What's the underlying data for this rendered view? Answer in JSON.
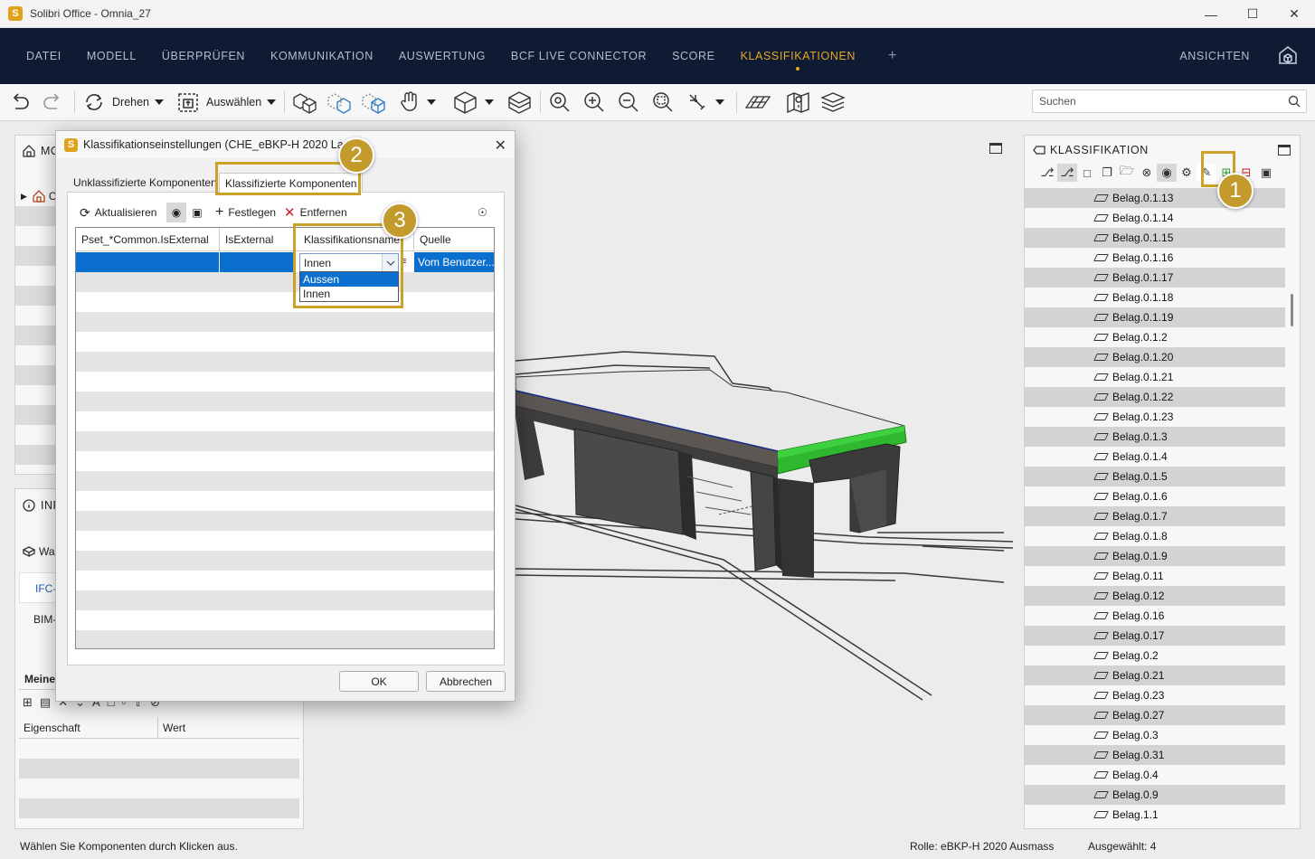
{
  "window": {
    "title": "Solibri Office - Omnia_27",
    "app_icon_letter": "S"
  },
  "menu": {
    "items": [
      "DATEI",
      "MODELL",
      "ÜBERPRÜFEN",
      "KOMMUNIKATION",
      "AUSWERTUNG",
      "BCF LIVE CONNECTOR",
      "SCORE",
      "KLASSIFIKATIONEN"
    ],
    "active": "KLASSIFIKATIONEN",
    "plus": "+",
    "right": "ANSICHTEN"
  },
  "toolbar": {
    "rotate_label": "Drehen",
    "select_label": "Auswählen",
    "search_placeholder": "Suchen"
  },
  "left_top": {
    "header": "MO",
    "tree_first_letter": "C"
  },
  "left_bottom": {
    "header": "INF",
    "line1": "Wa",
    "link": "IFC-",
    "line2": "BIM-",
    "tab": "Meine",
    "col1": "Eigenschaft",
    "col2": "Wert"
  },
  "right_panel": {
    "header": "KLASSIFIKATION",
    "items": [
      "Belag.0.1.13",
      "Belag.0.1.14",
      "Belag.0.1.15",
      "Belag.0.1.16",
      "Belag.0.1.17",
      "Belag.0.1.18",
      "Belag.0.1.19",
      "Belag.0.1.2",
      "Belag.0.1.20",
      "Belag.0.1.21",
      "Belag.0.1.22",
      "Belag.0.1.23",
      "Belag.0.1.3",
      "Belag.0.1.4",
      "Belag.0.1.5",
      "Belag.0.1.6",
      "Belag.0.1.7",
      "Belag.0.1.8",
      "Belag.0.1.9",
      "Belag.0.11",
      "Belag.0.12",
      "Belag.0.16",
      "Belag.0.17",
      "Belag.0.2",
      "Belag.0.21",
      "Belag.0.23",
      "Belag.0.27",
      "Belag.0.3",
      "Belag.0.31",
      "Belag.0.4",
      "Belag.0.9",
      "Belag.1.1"
    ]
  },
  "dialog": {
    "title": "Klassifikationseinstellungen (CHE_eBKP-H 2020 Lage)",
    "tab_unclassified": "Unklassifizierte Komponenten",
    "tab_classified": "Klassifizierte Komponenten",
    "refresh": "Aktualisieren",
    "set": "Festlegen",
    "remove": "Entfernen",
    "columns": [
      "Pset_*Common.IsExternal",
      "IsExternal",
      "Klassifikationsname",
      "Quelle"
    ],
    "selected_value": "Innen",
    "source_value": "Vom Benutzer...",
    "options": [
      "Aussen",
      "Innen"
    ],
    "ok": "OK",
    "cancel": "Abbrechen"
  },
  "callouts": [
    "1",
    "2",
    "3"
  ],
  "status": {
    "hint": "Wählen Sie Komponenten durch Klicken aus.",
    "role": "Rolle: eBKP-H 2020 Ausmass",
    "selected": "Ausgewählt: 4"
  },
  "colors": {
    "menubar": "#0f1b33",
    "accent": "#e3a823",
    "callout": "#c39a2c",
    "selection": "#0a6fcf",
    "green_element": "#2fb82f"
  }
}
